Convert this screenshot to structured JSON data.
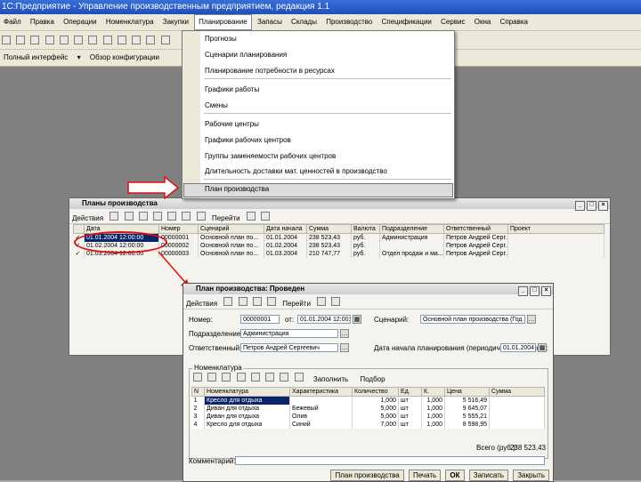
{
  "window": {
    "title": "1С:Предприятие - Управление производственным предприятием, редакция 1.1"
  },
  "menubar": {
    "items": [
      "Файл",
      "Правка",
      "Операции",
      "Номенклатура",
      "Закупки",
      "Планирование",
      "Запасы",
      "Склады",
      "Производство",
      "Спецификации",
      "Сервис",
      "Окна",
      "Справка"
    ],
    "active_index": 5
  },
  "toolbar2": {
    "interface_label": "Полный интерфейс",
    "review_label": "Обзор конфигурации"
  },
  "planning_menu": {
    "items": [
      {
        "label": "Прогнозы",
        "separator_after": false
      },
      {
        "label": "Сценарии планирования",
        "separator_after": false
      },
      {
        "label": "Планирование потребности в ресурсах",
        "separator_after": true
      },
      {
        "label": "Графики работы",
        "separator_after": false
      },
      {
        "label": "Смены",
        "separator_after": true
      },
      {
        "label": "Рабочие центры",
        "separator_after": false
      },
      {
        "label": "Графики рабочих центров",
        "separator_after": false
      },
      {
        "label": "Группы заменяемости рабочих центров",
        "separator_after": false
      },
      {
        "label": "Длительность доставки мат. ценностей в производство",
        "separator_after": true
      },
      {
        "label": "План производства",
        "separator_after": false
      }
    ],
    "selected_index": 9
  },
  "list_window": {
    "title": "Планы производства",
    "actions_label": "Действия",
    "goto_label": "Перейти",
    "columns": [
      "Дата",
      "Номер",
      "Сценарий",
      "Дата начала",
      "Сумма",
      "Валюта",
      "Подразделение",
      "Ответственный",
      "Проект"
    ],
    "rows": [
      [
        "01.01.2004 12:00:00",
        "00000001",
        "Основной план по...",
        "01.01.2004",
        "238 523,43",
        "руб.",
        "Администрация",
        "Петров Андрей Серг...",
        ""
      ],
      [
        "01.02.2004 12:00:00",
        "00000002",
        "Основной план по...",
        "01.02.2004",
        "238 523,43",
        "руб.",
        "",
        "Петров Андрей Серг...",
        ""
      ],
      [
        "01.03.2004 12:00:00",
        "00000003",
        "Основной план по...",
        "01.03.2004",
        "210 747,77",
        "руб.",
        "Отдел продаж и ма...",
        "Петров Андрей Серг...",
        ""
      ]
    ]
  },
  "form_window": {
    "title": "План производства: Проведен",
    "actions_label": "Действия",
    "goto_label": "Перейти",
    "number_label": "Номер:",
    "number_value": "00000001",
    "date_prefix": "от:",
    "date_value": "01.01.2004 12:00:00",
    "scenario_label": "Сценарий:",
    "scenario_value": "Основной план производства (Год 2004 - Месяц)",
    "department_label": "Подразделение:",
    "department_value": "Администрация",
    "responsible_label": "Ответственный:",
    "responsible_value": "Петров Андрей Сергеевич",
    "planning_date_label": "Дата начала планирования (периодичность: Месяц):",
    "planning_date_value": "01.01.2004",
    "nomenclature_label": "Номенклатура",
    "fill_label": "Заполнить",
    "select_label": "Подбор",
    "table_columns": [
      "N",
      "Номенклатура",
      "Характеристика",
      "Количество",
      "Ед.",
      "К.",
      "Цена",
      "Сумма"
    ],
    "table_rows": [
      [
        "1",
        "Кресло для отдыха",
        "",
        "1,000",
        "шт",
        "1,000",
        "5 516,49",
        ""
      ],
      [
        "2",
        "Диван для отдыха",
        "Бежевый",
        "5,000",
        "шт",
        "1,000",
        "9 645,07",
        ""
      ],
      [
        "3",
        "Диван для отдыха",
        "Олив",
        "5,000",
        "шт",
        "1,000",
        "5 555,21",
        ""
      ],
      [
        "4",
        "Кресло для отдыха",
        "Синий",
        "7,000",
        "шт",
        "1,000",
        "8 598,95",
        ""
      ]
    ],
    "total_label": "Всего (руб.):",
    "total_value": "238 523,43",
    "comment_label": "Комментарий:",
    "bottom_buttons": [
      "План производства",
      "Печать",
      "ОК",
      "Записать",
      "Закрыть"
    ]
  },
  "colors": {
    "annotation_red": "#e01010",
    "title_blue": "#1e4fb8",
    "selection": "#0a246a"
  }
}
